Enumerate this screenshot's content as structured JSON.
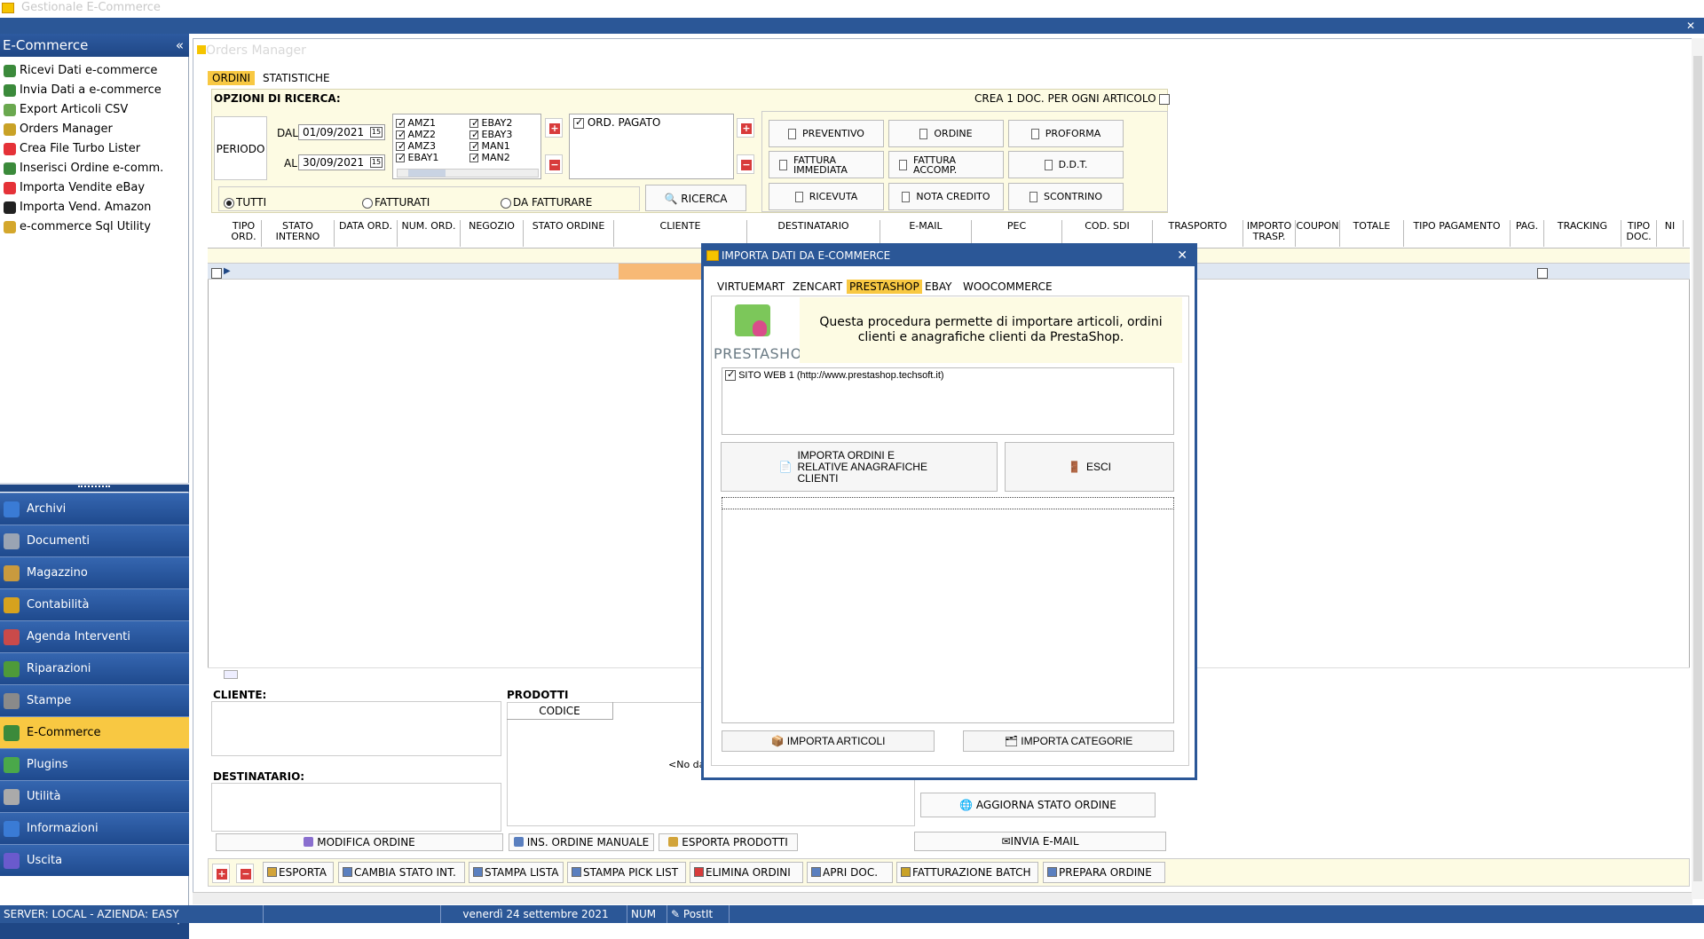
{
  "window": {
    "title": "Gestionale E-Commerce"
  },
  "sidebar": {
    "title": "E-Commerce",
    "items": [
      {
        "label": "Ricevi Dati e-commerce",
        "color": "#3b8a3b"
      },
      {
        "label": "Invia Dati a e-commerce",
        "color": "#3b8a3b"
      },
      {
        "label": "Export Articoli CSV",
        "color": "#6aa84f"
      },
      {
        "label": "Orders Manager",
        "color": "#c9a227"
      },
      {
        "label": "Crea File Turbo Lister",
        "color": "#e53238"
      },
      {
        "label": "Inserisci Ordine e-comm.",
        "color": "#3b8a3b"
      },
      {
        "label": "Importa Vendite eBay",
        "color": "#e53238"
      },
      {
        "label": "Importa Vend. Amazon",
        "color": "#222222"
      },
      {
        "label": "e-commerce Sql Utility",
        "color": "#d4a72c"
      }
    ],
    "nav": [
      {
        "label": "Archivi",
        "color": "#3a7bd5"
      },
      {
        "label": "Documenti",
        "color": "#9aa4b3"
      },
      {
        "label": "Magazzino",
        "color": "#c99a3e"
      },
      {
        "label": "Contabilità",
        "color": "#d6a21e"
      },
      {
        "label": "Agenda Interventi",
        "color": "#c94a4a"
      },
      {
        "label": "Riparazioni",
        "color": "#4e9a3a"
      },
      {
        "label": "Stampe",
        "color": "#8a8a8a"
      },
      {
        "label": "E-Commerce",
        "color": "#3b8a3b"
      },
      {
        "label": "Plugins",
        "color": "#4aa84a"
      },
      {
        "label": "Utilità",
        "color": "#aaaaaa"
      },
      {
        "label": "Informazioni",
        "color": "#3a7bd5"
      },
      {
        "label": "Uscita",
        "color": "#6a5acd"
      }
    ],
    "active_nav": "E-Commerce"
  },
  "main": {
    "title": "Orders Manager",
    "tabs": [
      "ORDINI",
      "STATISTICHE"
    ],
    "search": {
      "title": "OPZIONI DI RICERCA:",
      "crea_doc_label": "CREA 1 DOC. PER OGNI ARTICOLO",
      "periodo_label": "PERIODO",
      "dal_label": "DAL",
      "al_label": "AL",
      "dal_value": "01/09/2021",
      "al_value": "30/09/2021",
      "shops_col1": [
        "AMZ1",
        "AMZ2",
        "AMZ3",
        "EBAY1"
      ],
      "shops_col2": [
        "EBAY2",
        "EBAY3",
        "MAN1",
        "MAN2"
      ],
      "ord_pagato_label": "ORD. PAGATO",
      "radio_tutti": "TUTTI",
      "radio_fatturati": "FATTURATI",
      "radio_da_fatturare": "DA FATTURARE",
      "ricerca_label": "RICERCA"
    },
    "doc_buttons": [
      [
        "PREVENTIVO",
        "ORDINE",
        "PROFORMA"
      ],
      [
        "FATTURA IMMEDIATA",
        "FATTURA ACCOMP.",
        "D.D.T."
      ],
      [
        "RICEVUTA",
        "NOTA CREDITO",
        "SCONTRINO"
      ]
    ],
    "grid_columns": [
      "TIPO ORD.",
      "STATO INTERNO",
      "DATA ORD.",
      "NUM. ORD.",
      "NEGOZIO",
      "STATO ORDINE",
      "CLIENTE",
      "DESTINATARIO",
      "E-MAIL",
      "PEC",
      "COD. SDI",
      "TRASPORTO",
      "IMPORTO TRASP.",
      "COUPON",
      "TOTALE",
      "TIPO PAGAMENTO",
      "PAG.",
      "TRACKING",
      "TIPO DOC.",
      "NI"
    ],
    "lower": {
      "cliente_label": "CLIENTE:",
      "destinatario_label": "DESTINATARIO:",
      "prodotti_label": "PRODOTTI",
      "codice_header": "CODICE",
      "no_data": "<No da",
      "modifica_ordine": "MODIFICA ORDINE",
      "ins_ordine_manuale": "INS. ORDINE MANUALE",
      "esporta_prodotti": "ESPORTA PRODOTTI",
      "aggiorna_stato": "AGGIORNA STATO ORDINE",
      "invia_email": "INVIA E-MAIL"
    },
    "toolbar": [
      "ESPORTA",
      "CAMBIA STATO INT.",
      "STAMPA LISTA",
      "STAMPA PICK LIST",
      "ELIMINA ORDINI",
      "APRI DOC.",
      "FATTURAZIONE BATCH",
      "PREPARA ORDINE"
    ]
  },
  "dialog": {
    "title": "IMPORTA DATI DA E-COMMERCE",
    "tabs": [
      "VIRTUEMART",
      "ZENCART",
      "PRESTASHOP",
      "EBAY",
      "WOOCOMMERCE"
    ],
    "active_tab": "PRESTASHOP",
    "logo_text": "PRESTASHOP",
    "info": "Questa procedura permette di importare articoli, ordini clienti e anagrafiche clienti da PrestaShop.",
    "site": "SITO WEB 1 (http://www.prestashop.techsoft.it)",
    "importa_ordini": "IMPORTA ORDINI E RELATIVE ANAGRAFICHE CLIENTI",
    "esci": "ESCI",
    "importa_articoli": "IMPORTA ARTICOLI",
    "importa_categorie": "IMPORTA CATEGORIE"
  },
  "statusbar": {
    "server": "SERVER: LOCAL - AZIENDA: EASY",
    "date": "venerdì 24 settembre 2021",
    "num": "NUM",
    "postit": "PostIt"
  }
}
